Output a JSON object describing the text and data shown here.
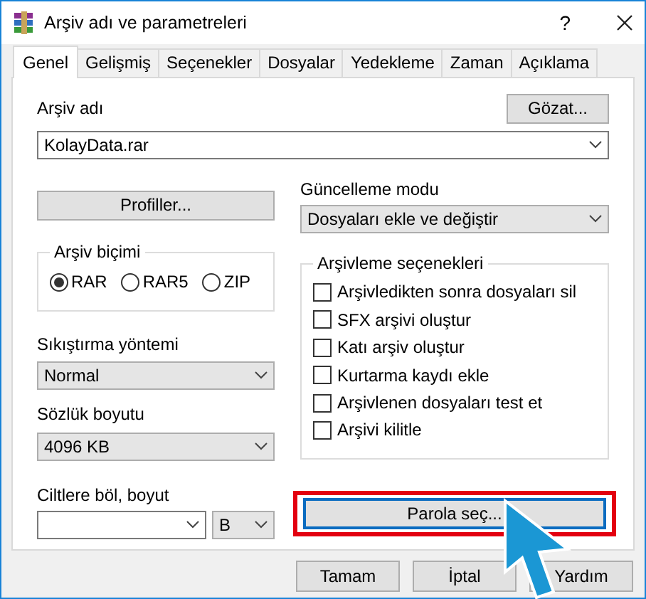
{
  "window": {
    "title": "Arşiv adı ve parametreleri",
    "help": "?"
  },
  "tabs": [
    {
      "label": "Genel",
      "selected": true
    },
    {
      "label": "Gelişmiş",
      "selected": false
    },
    {
      "label": "Seçenekler",
      "selected": false
    },
    {
      "label": "Dosyalar",
      "selected": false
    },
    {
      "label": "Yedekleme",
      "selected": false
    },
    {
      "label": "Zaman",
      "selected": false
    },
    {
      "label": "Açıklama",
      "selected": false
    }
  ],
  "archive_name": {
    "label": "Arşiv adı",
    "value": "KolayData.rar",
    "browse_button": "Gözat..."
  },
  "profiles_button": "Profiller...",
  "update_mode": {
    "label": "Güncelleme modu",
    "value": "Dosyaları ekle ve değiştir"
  },
  "archive_format": {
    "label": "Arşiv biçimi",
    "options": [
      {
        "label": "RAR",
        "selected": true
      },
      {
        "label": "RAR5",
        "selected": false
      },
      {
        "label": "ZIP",
        "selected": false
      }
    ]
  },
  "archiving_options": {
    "label": "Arşivleme seçenekleri",
    "options": [
      {
        "label": "Arşivledikten sonra dosyaları sil",
        "checked": false
      },
      {
        "label": "SFX arşivi oluştur",
        "checked": false
      },
      {
        "label": "Katı arşiv oluştur",
        "checked": false
      },
      {
        "label": "Kurtarma kaydı ekle",
        "checked": false
      },
      {
        "label": "Arşivlenen dosyaları test et",
        "checked": false
      },
      {
        "label": "Arşivi kilitle",
        "checked": false
      }
    ]
  },
  "compression": {
    "label": "Sıkıştırma yöntemi",
    "value": "Normal"
  },
  "dictionary": {
    "label": "Sözlük boyutu",
    "value": "4096 KB"
  },
  "split": {
    "label": "Ciltlere böl, boyut",
    "unit": "B"
  },
  "password_button": {
    "label": "Parola seç...",
    "highlighted": true
  },
  "buttons": [
    "Tamam",
    "İptal",
    "Yardım"
  ]
}
